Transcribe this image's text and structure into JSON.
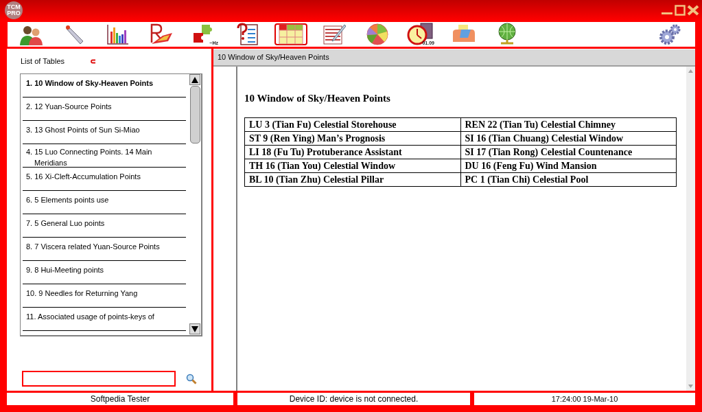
{
  "window": {
    "logo": [
      "TCM",
      "PRO"
    ]
  },
  "toolbar": [
    {
      "kind": "people",
      "selected": false
    },
    {
      "kind": "probe",
      "selected": false
    },
    {
      "kind": "bars",
      "selected": false
    },
    {
      "kind": "r-chart",
      "selected": false
    },
    {
      "kind": "puzzle",
      "selected": false,
      "badge": "~Hz"
    },
    {
      "kind": "question",
      "selected": false
    },
    {
      "kind": "table",
      "selected": true
    },
    {
      "kind": "notepad",
      "selected": false
    },
    {
      "kind": "pie",
      "selected": false
    },
    {
      "kind": "clock",
      "selected": false,
      "badge": "01.09"
    },
    {
      "kind": "printer",
      "selected": false
    },
    {
      "kind": "globe",
      "selected": false
    },
    {
      "kind": "gears",
      "selected": false
    }
  ],
  "sidebar": {
    "title": "List of Tables",
    "items": [
      {
        "label": "1. 10 Window of Sky-Heaven Points",
        "selected": true
      },
      {
        "label": "2. 12 Yuan-Source Points",
        "selected": false
      },
      {
        "label": "3. 13 Ghost Points of Sun Si-Miao",
        "selected": false
      },
      {
        "label": "4. 15 Luo Connecting Points. 14 Main Meridians",
        "selected": false
      },
      {
        "label": "5. 16 Xi-Cleft-Accumulation Points",
        "selected": false
      },
      {
        "label": "6. 5 Elements points use",
        "selected": false
      },
      {
        "label": "7. 5 General Luo points",
        "selected": false
      },
      {
        "label": "8. 7 Viscera related Yuan-Source Points",
        "selected": false
      },
      {
        "label": "9. 8 Hui-Meeting points",
        "selected": false
      },
      {
        "label": "10. 9 Needles for Returning Yang",
        "selected": false
      },
      {
        "label": "11. Associated usage of points-keys of",
        "selected": false
      }
    ]
  },
  "content": {
    "tab_title": "10 Window of Sky/Heaven Points",
    "heading": "10 Window of Sky/Heaven Points",
    "rows": [
      [
        "LU 3 (Tian Fu) Celestial Storehouse",
        "REN 22 (Tian Tu) Celestial Chimney"
      ],
      [
        "ST 9 (Ren Ying) Man’s Prognosis",
        "SI 16 (Tian Chuang) Celestial Window"
      ],
      [
        "LI 18 (Fu Tu) Protuberance Assistant",
        "SI 17 (Tian Rong) Celestial Countenance"
      ],
      [
        "TH 16 (Tian You) Celestial Window",
        "DU 16 (Feng Fu) Wind Mansion"
      ],
      [
        "BL 10 (Tian Zhu) Celestial Pillar",
        "PC 1 (Tian Chi) Celestial Pool"
      ]
    ]
  },
  "status_bar": [
    "Softpedia Tester",
    "Device ID: device is not connected.",
    "17:24:00  19-Mar-10"
  ]
}
